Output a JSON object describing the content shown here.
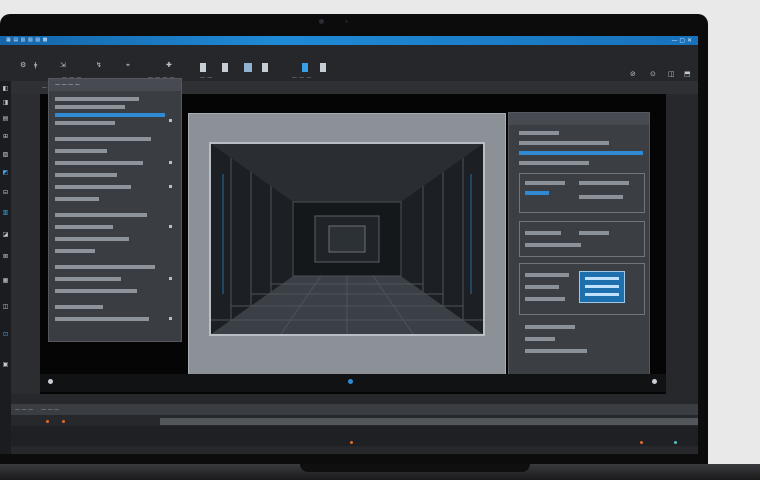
{
  "window": {
    "title_left": "▦ ▤ ▥ ▧ ▨ ▩",
    "title_right": "— ▢ ✕"
  },
  "toolbar": {
    "items": [
      "⚙",
      "ǂ",
      "⇲",
      "↯",
      "⌖",
      "✚",
      "⌗",
      "⛶",
      "⬚"
    ],
    "labels": [
      "— — —",
      "— — — —",
      "— —",
      "— — —"
    ],
    "right_icons": [
      "⊘",
      "⊙",
      "◫",
      "⬒"
    ]
  },
  "subbar": {
    "text": "— — — — — — — —"
  },
  "left_strip": {
    "icons": [
      "◧",
      "◨",
      "▤",
      "⊞",
      "▧",
      "◩",
      "⊟",
      "▥",
      "◪",
      "⊠",
      "▦",
      "◫",
      "⊡",
      "▣"
    ]
  },
  "left_panel": {
    "header": "— — — —"
  },
  "bottom": {
    "left_label": "— — —",
    "left_label2": "— — —"
  },
  "colors": {
    "accent": "#2f8ad3",
    "titlebar": "#1f8ad6",
    "marker": "#e06a2c",
    "teal": "#4fc3c8"
  },
  "icons": {
    "viewport": "corridor-3d-render-icon",
    "play": "play-icon"
  }
}
